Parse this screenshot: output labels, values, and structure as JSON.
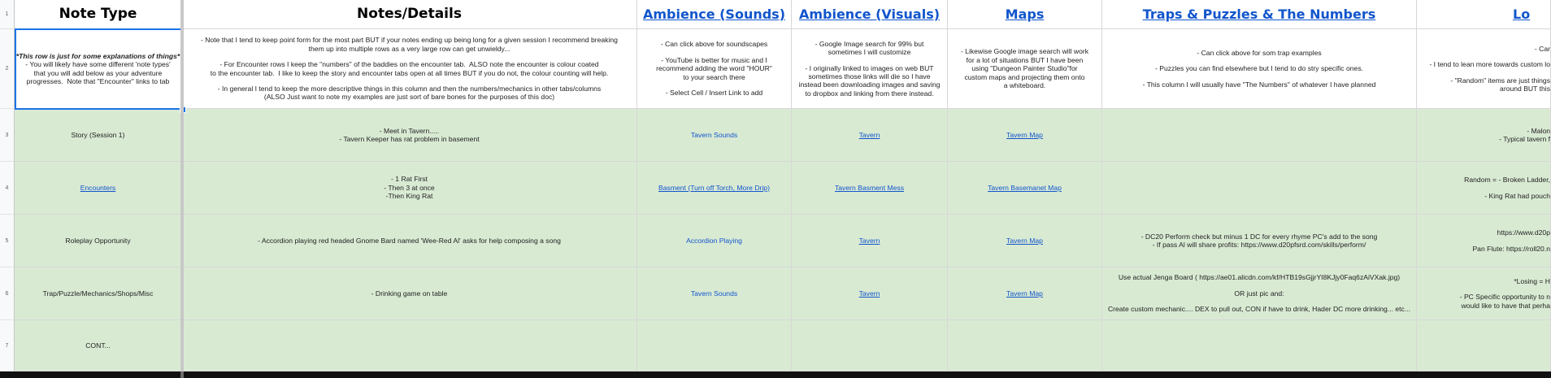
{
  "row_numbers": [
    "1",
    "2",
    "3",
    "4",
    "5",
    "6",
    "7"
  ],
  "headers": [
    "Note Type",
    "Notes/Details",
    "Ambience (Sounds)",
    "Ambience (Visuals)",
    "Maps",
    "Traps & Puzzles & The Numbers",
    "Lo"
  ],
  "row2": {
    "note_type": [
      "*This row is just for some explanations of things*",
      "- You will likely have some different 'note types'",
      "that you will add below as your adventure",
      "progresses.  Note that \"Encounter\" links to tab"
    ],
    "notes": [
      "- Note that I tend to keep point form for the most part BUT if your notes ending up being long for a given session I recommend breaking",
      "them up into multiple rows as a very large row can get unwieldy...",
      "",
      "- For Encounter rows I keep the \"numbers\" of the baddies on the encounter tab.  ALSO note the encounter is colour coated",
      "to the encounter tab.  I like to keep the story and encounter tabs open at all times BUT if you do not, the colour counting will help.",
      "",
      "- In general I tend to keep the more descriptive things in this column and then the numbers/mechanics in other tabs/columns",
      "(ALSO Just want to note my examples are just sort of bare bones for the purposes of this doc)"
    ],
    "sounds": [
      "- Can click above for soundscapes",
      "",
      "- YouTube is better for music and I",
      "recommend adding the word \"HOUR\"",
      "to your search there",
      "",
      "- Select Cell / Insert Link to add"
    ],
    "visuals": [
      "- Google Image search for 99% but",
      "sometimes I will customize",
      "",
      "- I originally linked to images on web BUT",
      "sometimes those links will die so I have",
      "instead been downloading images and saving",
      "to dropbox and linking from there instead."
    ],
    "maps": [
      "- Likewise Google image search will work",
      "for a lot of situations BUT I have been",
      "using \"Dungeon Painter Studio\"for",
      "custom maps and projecting them onto",
      "a whiteboard."
    ],
    "traps": [
      "- Can click above for som trap examples",
      "",
      "- Puzzles you can find elsewhere but I tend to do stry specific ones.",
      "",
      "- This column I will usually have \"The Numbers\" of whatever I have planned"
    ],
    "loot": [
      "- Car",
      "",
      "- I tend to lean more towards custom lo",
      "",
      "- \"Random\" items are just things",
      "around BUT this"
    ]
  },
  "row3": {
    "note_type": "Story (Session 1)",
    "notes": [
      "- Meet in Tavern.....",
      "- Tavern Keeper has rat problem in basement"
    ],
    "sounds": "Tavern Sounds",
    "visuals": "Tavern",
    "maps": "Tavern Map",
    "traps": [],
    "loot": [
      "- Malon",
      "- Typical tavern f"
    ]
  },
  "row4": {
    "note_type": "Encounters",
    "notes": [
      "- 1 Rat First",
      "- Then 3 at once",
      "-Then King Rat"
    ],
    "sounds": "Basment (Turn off Torch, More Drip)",
    "visuals": "Tavern Basment  Mess",
    "maps": "Tavern Basemanet Map",
    "traps": [],
    "loot": [
      "Random = - Broken Ladder,",
      "",
      "- King Rat had pouch"
    ]
  },
  "row5": {
    "note_type": "Roleplay Opportunity",
    "notes": [
      "- Accordion playing red headed Gnome Bard named 'Wee-Red Al' asks for help composing a song"
    ],
    "sounds": "Accordion Playing",
    "visuals": "Tavern",
    "maps": "Tavern Map",
    "traps": [
      "- DC20 Perform check but minus 1 DC for every rhyme PC's add to the song",
      "- If pass Al will share profits: https://www.d20pfsrd.com/skills/perform/"
    ],
    "loot": [
      "https://www.d20p",
      "",
      "Pan Flute: https://roll20.n"
    ]
  },
  "row6": {
    "note_type": "Trap/Puzzle/Mechanics/Shops/Misc",
    "notes": [
      "- Drinking game on table"
    ],
    "sounds": "Tavern Sounds",
    "visuals": "Tavern",
    "maps": "Tavern Map",
    "traps": [
      "Use actual Jenga Board ( https://ae01.alicdn.com/kf/HTB19sGjjrYI8KJjy0Faq6zAiVXak.jpg)",
      "",
      "OR just pic and:",
      "",
      "Create custom mechanic.... DEX to pull out, CON if have to drink, Hader DC more drinking... etc..."
    ],
    "loot": [
      "*Losing = H",
      "",
      "- PC Specific opportunity to n",
      "would like to have that perha"
    ]
  },
  "row7": {
    "note_type": "CONT..."
  }
}
